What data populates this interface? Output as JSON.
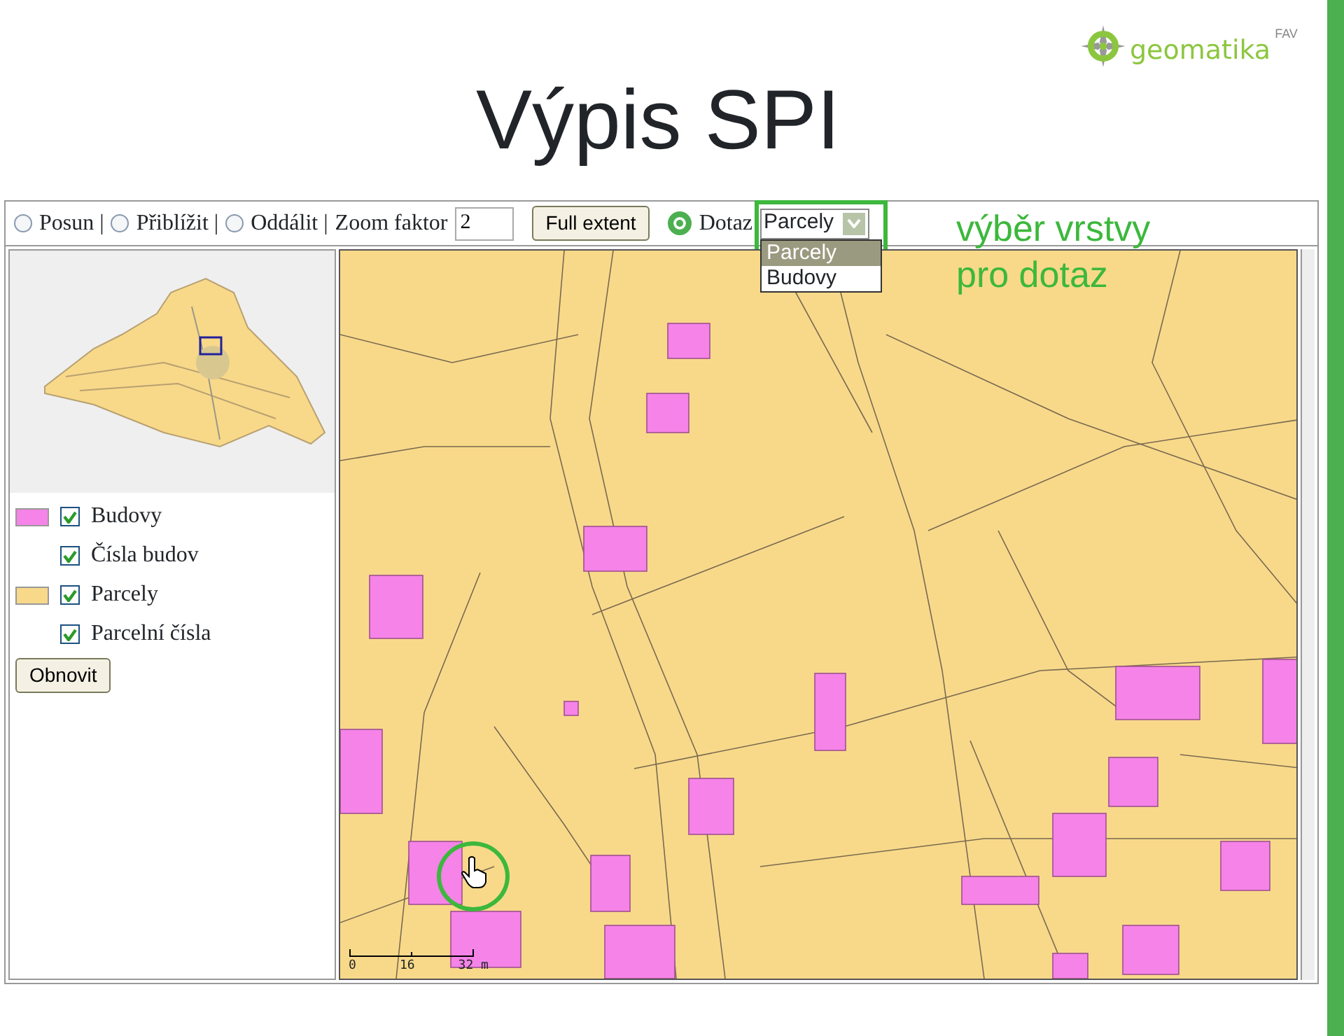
{
  "slide": {
    "title": "Výpis SPI",
    "logo": {
      "text": "geomatika",
      "superscript": "FAV"
    }
  },
  "toolbar": {
    "tools": [
      {
        "label": "Posun |",
        "selected": false
      },
      {
        "label": "Přiblížit |",
        "selected": false
      },
      {
        "label": "Oddálit |",
        "selected": false
      }
    ],
    "zoom_factor": {
      "label": "Zoom faktor",
      "value": "2"
    },
    "full_extent_button": "Full extent",
    "query": {
      "label": "Dotaz",
      "selected": true
    },
    "layer_select": {
      "value": "Parcely",
      "expanded": true,
      "options": [
        {
          "label": "Parcely",
          "selected": true
        },
        {
          "label": "Budovy",
          "selected": false
        }
      ]
    }
  },
  "annotation": {
    "lines": [
      "výběr vrstvy",
      "pro dotaz"
    ]
  },
  "legend": [
    {
      "label": "Budovy",
      "checked": true,
      "color": "#f583e8"
    },
    {
      "label": "Čísla budov",
      "checked": true
    },
    {
      "label": "Parcely",
      "checked": true,
      "color": "#f8d98a"
    },
    {
      "label": "Parcelní čísla",
      "checked": true
    }
  ],
  "refresh_button": "Obnovit",
  "scale_bar": {
    "labels": [
      "0",
      "16",
      "32 m"
    ]
  }
}
